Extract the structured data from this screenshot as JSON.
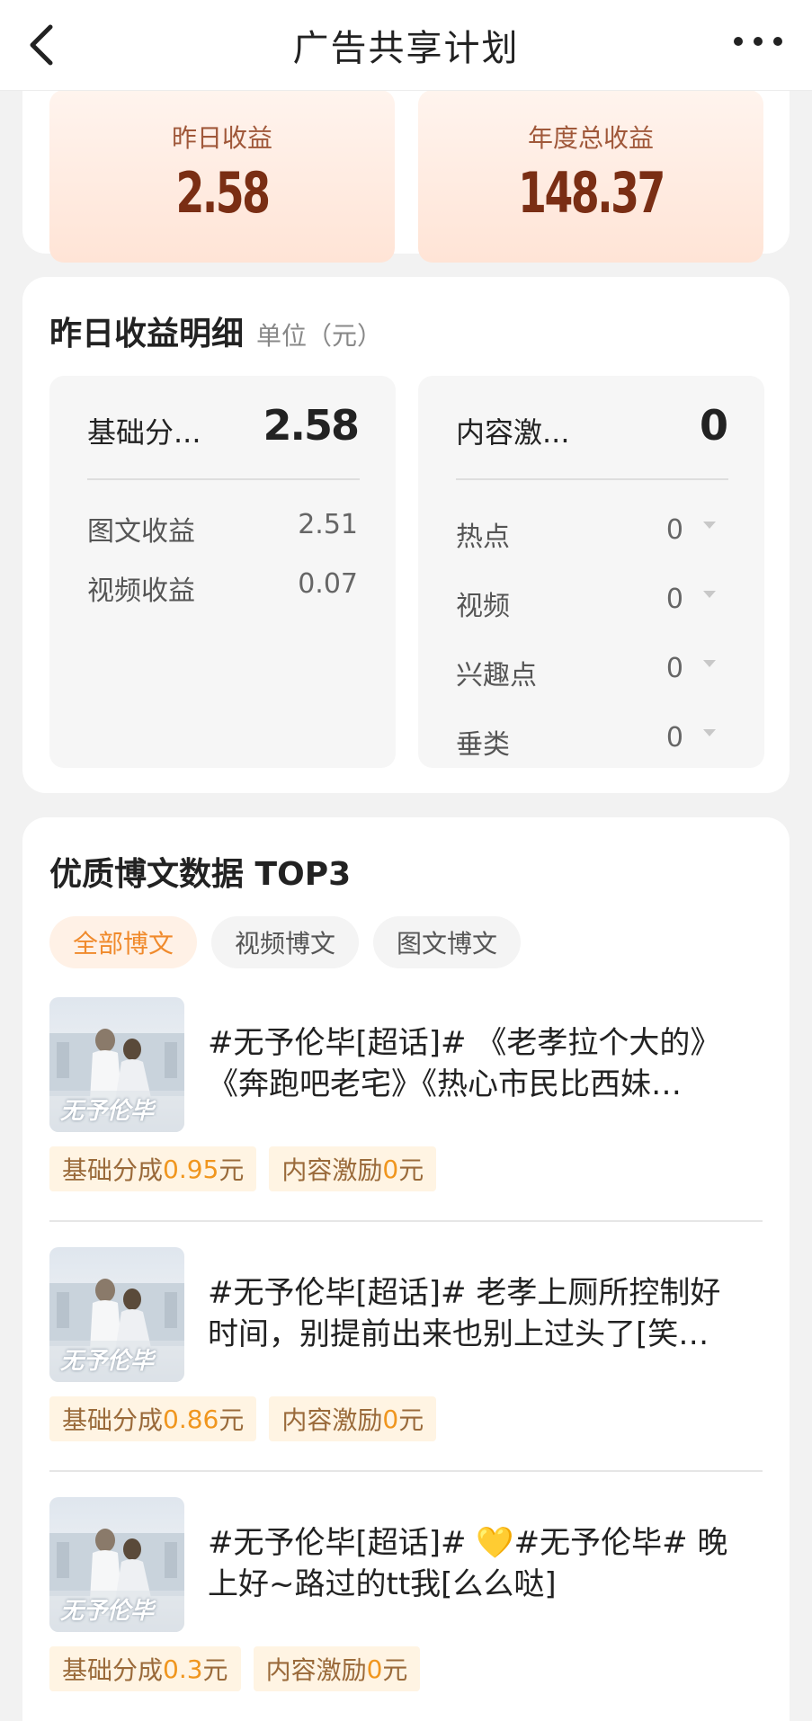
{
  "header": {
    "title": "广告共享计划"
  },
  "summary": {
    "yesterday_label": "昨日收益",
    "yesterday_value": "2.58",
    "annual_label": "年度总收益",
    "annual_value": "148.37"
  },
  "detail": {
    "title": "昨日收益明细",
    "unit": "单位（元）",
    "base": {
      "name": "基础分...",
      "value": "2.58",
      "rows": [
        {
          "name": "图文收益",
          "value": "2.51"
        },
        {
          "name": "视频收益",
          "value": "0.07"
        }
      ]
    },
    "incentive": {
      "name": "内容激...",
      "value": "0",
      "rows": [
        {
          "name": "热点",
          "value": "0"
        },
        {
          "name": "视频",
          "value": "0"
        },
        {
          "name": "兴趣点",
          "value": "0"
        },
        {
          "name": "垂类",
          "value": "0"
        }
      ]
    }
  },
  "top3": {
    "title": "优质博文数据 TOP3",
    "tabs": [
      "全部博文",
      "视频博文",
      "图文博文"
    ],
    "thumb_text": "无予伦毕",
    "posts": [
      {
        "line1": "#无予伦毕[超话]# 《老孝拉个大的》",
        "line2": "《奔跑吧老宅》《热心市民比西妹…",
        "base_label": "基础分成",
        "base_value": "0.95",
        "base_unit": "元",
        "inc_label": "内容激励",
        "inc_value": "0",
        "inc_unit": "元"
      },
      {
        "line1": "#无予伦毕[超话]# 老孝上厕所控制好",
        "line2": "时间，别提前出来也别上过头了[笑…",
        "base_label": "基础分成",
        "base_value": "0.86",
        "base_unit": "元",
        "inc_label": "内容激励",
        "inc_value": "0",
        "inc_unit": "元"
      },
      {
        "line1": "#无予伦毕[超话]# 💛#无予伦毕# 晚",
        "line2": "上好~路过的tt我[么么哒]",
        "base_label": "基础分成",
        "base_value": "0.3",
        "base_unit": "元",
        "inc_label": "内容激励",
        "inc_value": "0",
        "inc_unit": "元"
      }
    ]
  }
}
